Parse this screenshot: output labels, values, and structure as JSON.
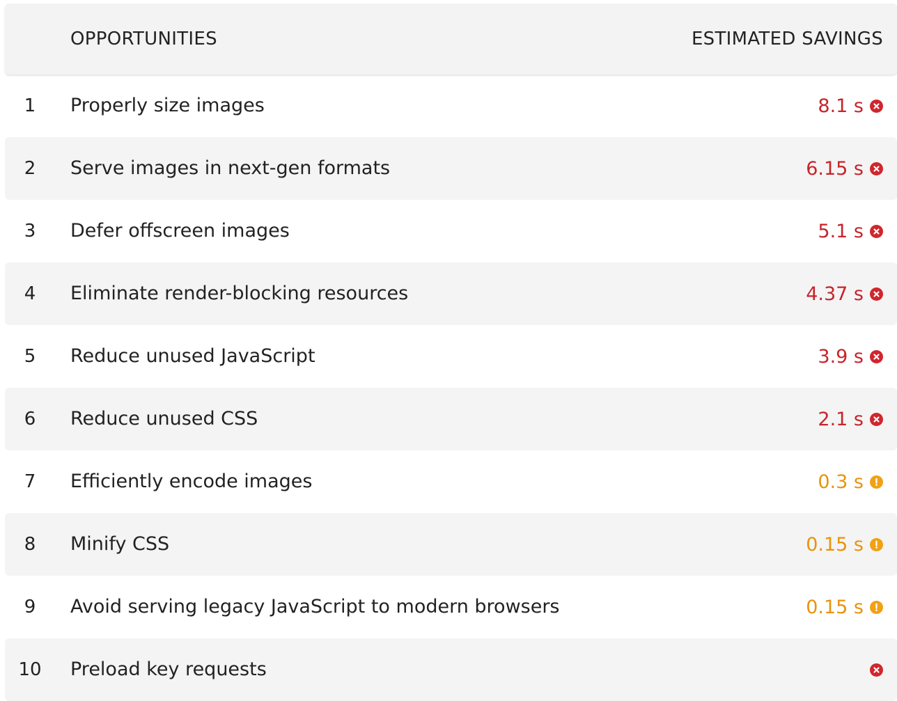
{
  "header": {
    "col_title": "OPPORTUNITIES",
    "col_savings": "ESTIMATED SAVINGS"
  },
  "colors": {
    "error": "#c6242b",
    "warning": "#e8930c"
  },
  "rows": [
    {
      "num": "1",
      "title": "Properly size images",
      "savings": "8.1 s",
      "severity": "error",
      "icon": "error-x-icon"
    },
    {
      "num": "2",
      "title": "Serve images in next-gen formats",
      "savings": "6.15 s",
      "severity": "error",
      "icon": "error-x-icon"
    },
    {
      "num": "3",
      "title": "Defer offscreen images",
      "savings": "5.1 s",
      "severity": "error",
      "icon": "error-x-icon"
    },
    {
      "num": "4",
      "title": "Eliminate render-blocking resources",
      "savings": "4.37 s",
      "severity": "error",
      "icon": "error-x-icon"
    },
    {
      "num": "5",
      "title": "Reduce unused JavaScript",
      "savings": "3.9 s",
      "severity": "error",
      "icon": "error-x-icon"
    },
    {
      "num": "6",
      "title": "Reduce unused CSS",
      "savings": "2.1 s",
      "severity": "error",
      "icon": "error-x-icon"
    },
    {
      "num": "7",
      "title": "Efficiently encode images",
      "savings": "0.3 s",
      "severity": "warning",
      "icon": "warning-exclamation-icon"
    },
    {
      "num": "8",
      "title": "Minify CSS",
      "savings": "0.15 s",
      "severity": "warning",
      "icon": "warning-exclamation-icon"
    },
    {
      "num": "9",
      "title": "Avoid serving legacy JavaScript to modern browsers",
      "savings": "0.15 s",
      "severity": "warning",
      "icon": "warning-exclamation-icon"
    },
    {
      "num": "10",
      "title": "Preload key requests",
      "savings": "",
      "severity": "error",
      "icon": "error-x-icon"
    }
  ]
}
